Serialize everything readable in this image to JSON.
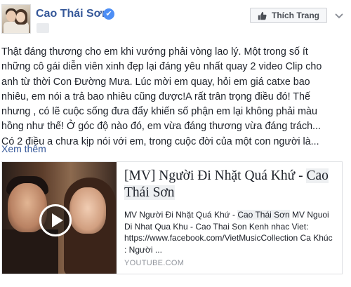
{
  "page": {
    "name": "Cao Thái Sơn",
    "verified_badge": "✔",
    "like_button_label": "Thích Trang",
    "menu_icon": "chevron-down-icon"
  },
  "post": {
    "lines": [
      "Thật đáng thương cho em khi vướng phải vòng lao lý. Một trong số ít",
      "những cô gái diễn viên xinh đẹp lại đáng yêu nhất quay 2 video Clip cho",
      "anh từ thời Con Đường Mưa. Lúc mời em quay, hỏi em giá catxe bao",
      "nhiêu, em nói a trả bao nhiêu cũng được!A rất trân trọng điều đó! Thế",
      "nhưng , có lẽ cuộc sống đưa đẩy khiến số phận em lại không phải màu",
      "hồng như thế! Ở góc độ nào đó, em vừa đáng thương vừa đáng trách...",
      "Có 2 điều a chưa kịp nói với em, trong cuộc đời của một con người là..."
    ],
    "see_more": "Xem thêm"
  },
  "link_card": {
    "title_prefix": "[MV] Người Đi Nhặt Quá Khứ - ",
    "title_highlight": "Cao Thái Sơn",
    "desc_part1": "MV Người Đi Nhặt Quá Khứ - ",
    "desc_highlight": "Cao Thái Sơn",
    "desc_part2": " MV Nguoi Di Nhat Qua Khu - Cao Thai Son Kenh nhac Viet: https://www.facebook.com/VietMusicCollection Ca Khúc : Người ...",
    "domain": "YOUTUBE.COM",
    "play_icon": "play-icon"
  },
  "colors": {
    "link_blue": "#365899",
    "verified_blue": "#4d8ef5",
    "text": "#1d2129",
    "muted": "#90949c"
  }
}
